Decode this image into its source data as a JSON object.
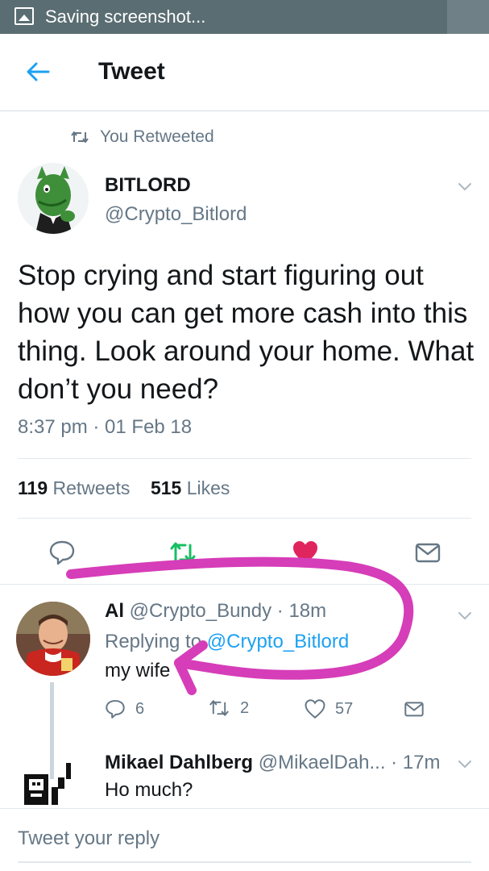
{
  "status_bar": {
    "text": "Saving screenshot..."
  },
  "header": {
    "title": "Tweet"
  },
  "retweet_context": {
    "label": "You Retweeted"
  },
  "tweet": {
    "author_name": "BITLORD",
    "author_handle": "@Crypto_Bitlord",
    "text": "Stop crying and start figuring out how you can get more cash into this thing. Look around your home. What don’t you need?",
    "timestamp": "8:37 pm · 01 Feb 18",
    "retweets_count": "119",
    "retweets_label": "Retweets",
    "likes_count": "515",
    "likes_label": "Likes"
  },
  "replies": [
    {
      "name": "Al",
      "handle": "@Crypto_Bundy",
      "time": "· 18m",
      "replying_prefix": "Replying to",
      "replying_to": "@Crypto_Bitlord",
      "text": "my wife",
      "reply_count": "6",
      "retweet_count": "2",
      "like_count": "57"
    },
    {
      "name": "Mikael Dahlberg",
      "handle": "@MikaelDah...",
      "time": "· 17m",
      "text": "Ho much?"
    }
  ],
  "composer": {
    "placeholder": "Tweet your reply"
  },
  "colors": {
    "accent_blue": "#1da1f2",
    "retweet_green": "#17bf63",
    "like_red": "#e0245e",
    "annotation_magenta": "#d63db8",
    "status_bar": "#5a6d72"
  }
}
